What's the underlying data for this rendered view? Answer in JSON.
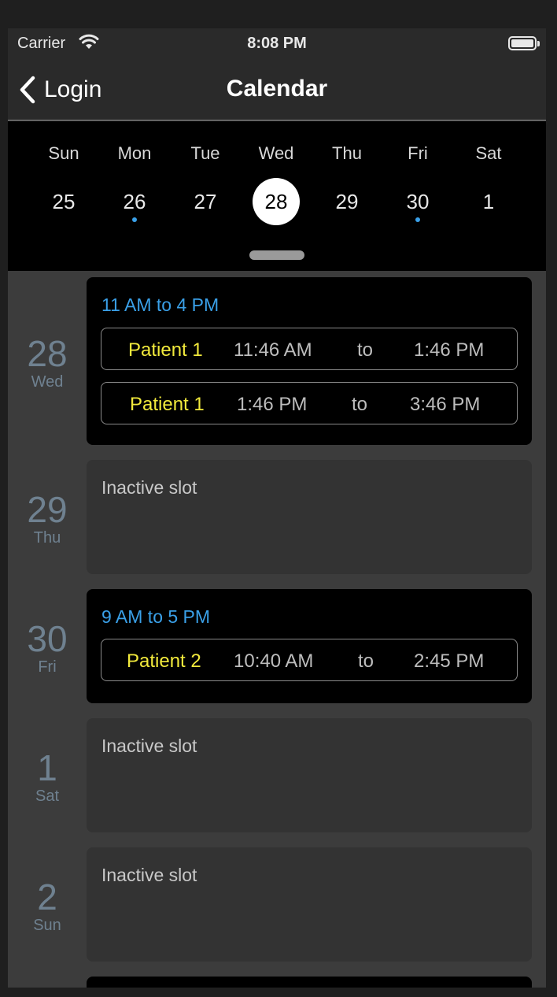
{
  "status_bar": {
    "carrier": "Carrier",
    "time": "8:08 PM"
  },
  "nav": {
    "back_label": "Login",
    "title": "Calendar"
  },
  "week": {
    "days": [
      {
        "dow": "Sun",
        "date": "25",
        "selected": false,
        "dot": false
      },
      {
        "dow": "Mon",
        "date": "26",
        "selected": false,
        "dot": true
      },
      {
        "dow": "Tue",
        "date": "27",
        "selected": false,
        "dot": false
      },
      {
        "dow": "Wed",
        "date": "28",
        "selected": true,
        "dot": false
      },
      {
        "dow": "Thu",
        "date": "29",
        "selected": false,
        "dot": false
      },
      {
        "dow": "Fri",
        "date": "30",
        "selected": false,
        "dot": true
      },
      {
        "dow": "Sat",
        "date": "1",
        "selected": false,
        "dot": false
      }
    ]
  },
  "schedule": [
    {
      "day_num": "28",
      "day_name": "Wed",
      "active": true,
      "range": "11 AM to 4 PM",
      "appointments": [
        {
          "patient": "Patient 1",
          "start": "11:46 AM",
          "sep": "to",
          "end": "1:46 PM"
        },
        {
          "patient": "Patient 1",
          "start": "1:46 PM",
          "sep": "to",
          "end": "3:46 PM"
        }
      ]
    },
    {
      "day_num": "29",
      "day_name": "Thu",
      "active": false,
      "status": "Inactive slot"
    },
    {
      "day_num": "30",
      "day_name": "Fri",
      "active": true,
      "range": "9 AM to 5 PM",
      "appointments": [
        {
          "patient": "Patient 2",
          "start": "10:40 AM",
          "sep": "to",
          "end": "2:45 PM"
        }
      ]
    },
    {
      "day_num": "1",
      "day_name": "Sat",
      "active": false,
      "status": "Inactive slot"
    },
    {
      "day_num": "2",
      "day_name": "Sun",
      "active": false,
      "status": "Inactive slot"
    }
  ],
  "colors": {
    "accent_blue": "#3aa0e8",
    "patient_yellow": "#f2ea3c",
    "day_label": "#6f8190"
  }
}
